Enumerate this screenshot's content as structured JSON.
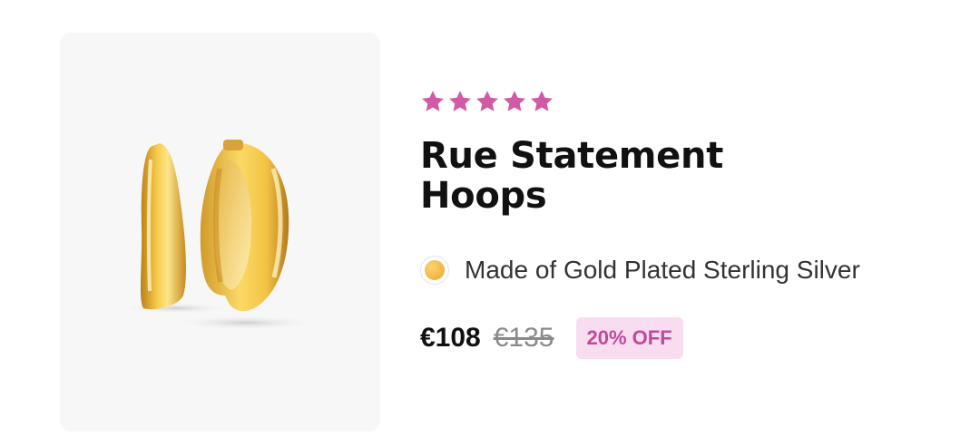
{
  "product": {
    "image_alt": "gold hoop earrings",
    "rating": {
      "value": 5,
      "max": 5,
      "star_color": "#d15aa6"
    },
    "title": "Rue Statement Hoops",
    "material": {
      "text": "Made of Gold Plated Sterling Silver",
      "swatch_color": "#f1b23e"
    },
    "price": {
      "current": "€108",
      "original": "€135",
      "discount_label": "20% OFF",
      "discount_bg": "#f8dcef",
      "discount_text_color": "#c2489a"
    }
  }
}
